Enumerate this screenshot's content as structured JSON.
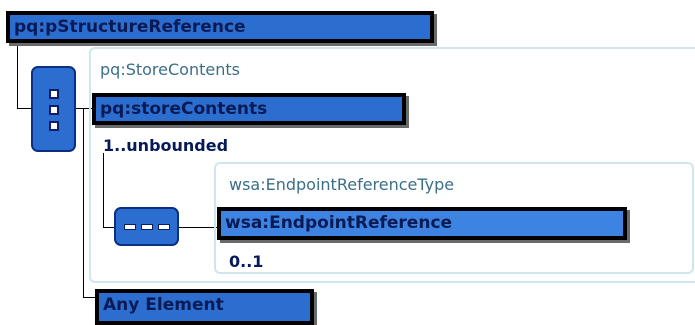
{
  "root": {
    "label": "pq:pStructureReference"
  },
  "store_contents": {
    "type_label": "pq:StoreContents",
    "element_label": "pq:storeContents",
    "occurrence": "1..unbounded"
  },
  "endpoint": {
    "type_label": "wsa:EndpointReferenceType",
    "element_label": "wsa:EndpointReference",
    "occurrence": "0..1"
  },
  "any_element": {
    "label": "Any Element"
  },
  "colors": {
    "element_fill": "#2b6ecf",
    "element_border": "#000000",
    "type_frame": "#cfe6ef",
    "type_text": "#3a6f88",
    "occurrence_text": "#061a5a"
  }
}
